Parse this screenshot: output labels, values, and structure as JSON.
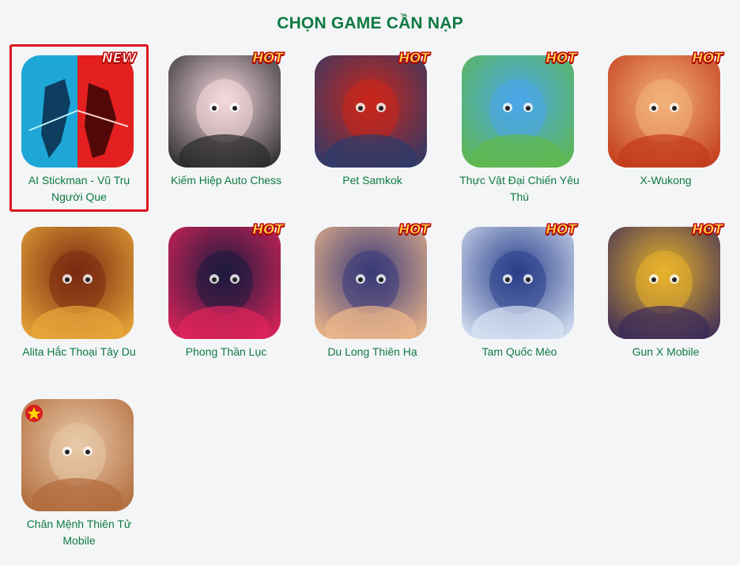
{
  "page": {
    "title": "CHỌN GAME CẦN NẠP"
  },
  "games": [
    {
      "name": "AI Stickman - Vũ Trụ Người Que",
      "badge": "NEW",
      "selected": true,
      "palette": [
        "#1ea7d6",
        "#e41f1f"
      ]
    },
    {
      "name": "Kiếm Hiệp Auto Chess",
      "badge": "HOT",
      "selected": false,
      "palette": [
        "#f6d9df",
        "#2a2a2a"
      ]
    },
    {
      "name": "Pet Samkok",
      "badge": "HOT",
      "selected": false,
      "palette": [
        "#c8261a",
        "#2c3a6a"
      ]
    },
    {
      "name": "Thực Vật Đại Chiến Yêu Thú",
      "badge": "HOT",
      "selected": false,
      "palette": [
        "#4aa6e8",
        "#5fb84a"
      ]
    },
    {
      "name": "X-Wukong",
      "badge": "HOT",
      "selected": false,
      "palette": [
        "#f2b27a",
        "#c23a1a"
      ]
    },
    {
      "name": "Alita Hắc Thoại Tây Du",
      "badge": "",
      "selected": false,
      "palette": [
        "#7a2a10",
        "#e9a83a"
      ]
    },
    {
      "name": "Phong Thần Lục",
      "badge": "HOT",
      "selected": false,
      "palette": [
        "#1e1a3e",
        "#e0245a"
      ]
    },
    {
      "name": "Du Long Thiên Hạ",
      "badge": "HOT",
      "selected": false,
      "palette": [
        "#3a3b7a",
        "#f0b88a"
      ]
    },
    {
      "name": "Tam Quốc Mèo",
      "badge": "HOT",
      "selected": false,
      "palette": [
        "#2a3f8a",
        "#d8e4f4"
      ]
    },
    {
      "name": "Gun X Mobile",
      "badge": "HOT",
      "selected": false,
      "palette": [
        "#e8b22a",
        "#3a2a5a"
      ]
    },
    {
      "name": "Chân Mệnh Thiên Tử Mobile",
      "badge": "",
      "selected": false,
      "palette": [
        "#e8c9a8",
        "#b06a3a"
      ]
    }
  ]
}
